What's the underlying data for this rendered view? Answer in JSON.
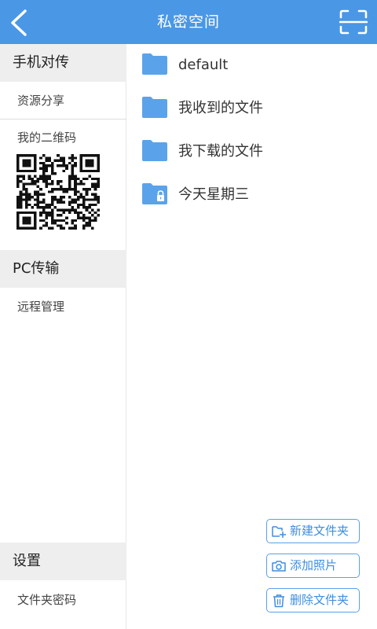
{
  "header": {
    "title": "私密空间",
    "back_icon": "chevron-left-icon",
    "scan_icon": "scan-frame-icon"
  },
  "sidebar": {
    "phone_transfer": {
      "heading": "手机对传",
      "resource_share": "资源分享",
      "my_qr_code": "我的二维码"
    },
    "pc_transfer": {
      "heading": "PC传输",
      "remote_manage": "远程管理"
    },
    "settings": {
      "heading": "设置",
      "folder_password": "文件夹密码"
    }
  },
  "files": [
    {
      "name": "default",
      "icon": "folder-icon",
      "locked": false
    },
    {
      "name": "我收到的文件",
      "icon": "folder-icon",
      "locked": false
    },
    {
      "name": "我下载的文件",
      "icon": "folder-icon",
      "locked": false
    },
    {
      "name": "今天星期三",
      "icon": "locked-folder-icon",
      "locked": true
    }
  ],
  "actions": {
    "new_folder": "新建文件夹",
    "add_photo": "添加照片",
    "delete_folder": "删除文件夹"
  },
  "colors": {
    "header": "#4a97e6",
    "folder": "#5aa3ea",
    "accent": "#3d8ee0",
    "section_bg": "#eeeeee"
  }
}
